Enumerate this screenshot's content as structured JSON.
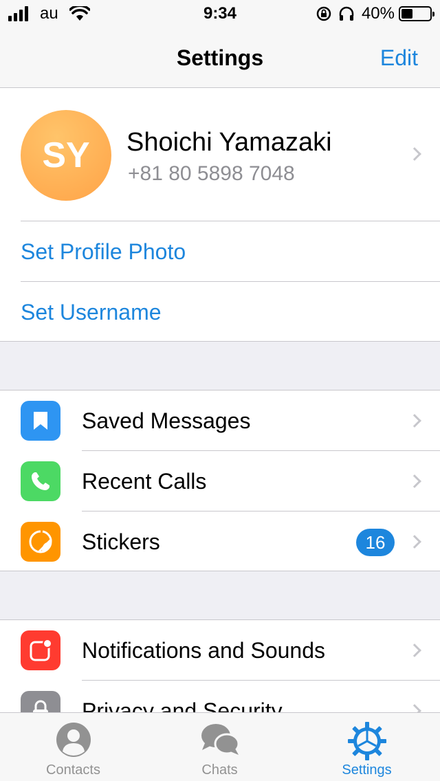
{
  "status_bar": {
    "carrier": "au",
    "time": "9:34",
    "battery_percent": "40%",
    "battery_level": 0.4
  },
  "nav": {
    "title": "Settings",
    "edit_label": "Edit"
  },
  "profile": {
    "initials": "SY",
    "name": "Shoichi Yamazaki",
    "phone": "+81 80 5898 7048",
    "avatar_color": "#ffab4f",
    "set_photo_label": "Set Profile Photo",
    "set_username_label": "Set Username"
  },
  "menu": [
    {
      "label": "Saved Messages",
      "icon": "bookmark-icon",
      "color": "#2e95f2"
    },
    {
      "label": "Recent Calls",
      "icon": "phone-icon",
      "color": "#4cd964"
    },
    {
      "label": "Stickers",
      "icon": "sticker-icon",
      "color": "#ff9500",
      "badge": "16"
    }
  ],
  "menu2": [
    {
      "label": "Notifications and Sounds",
      "icon": "notification-icon",
      "color": "#ff3b30"
    },
    {
      "label": "Privacy and Security",
      "icon": "lock-icon",
      "color": "#8e8e93"
    }
  ],
  "tabs": [
    {
      "label": "Contacts",
      "icon": "contacts-icon"
    },
    {
      "label": "Chats",
      "icon": "chats-icon"
    },
    {
      "label": "Settings",
      "icon": "settings-gear-icon",
      "active": true
    }
  ],
  "colors": {
    "accent": "#1d86dd",
    "separator": "#c8c7cc",
    "background": "#efeff4"
  }
}
